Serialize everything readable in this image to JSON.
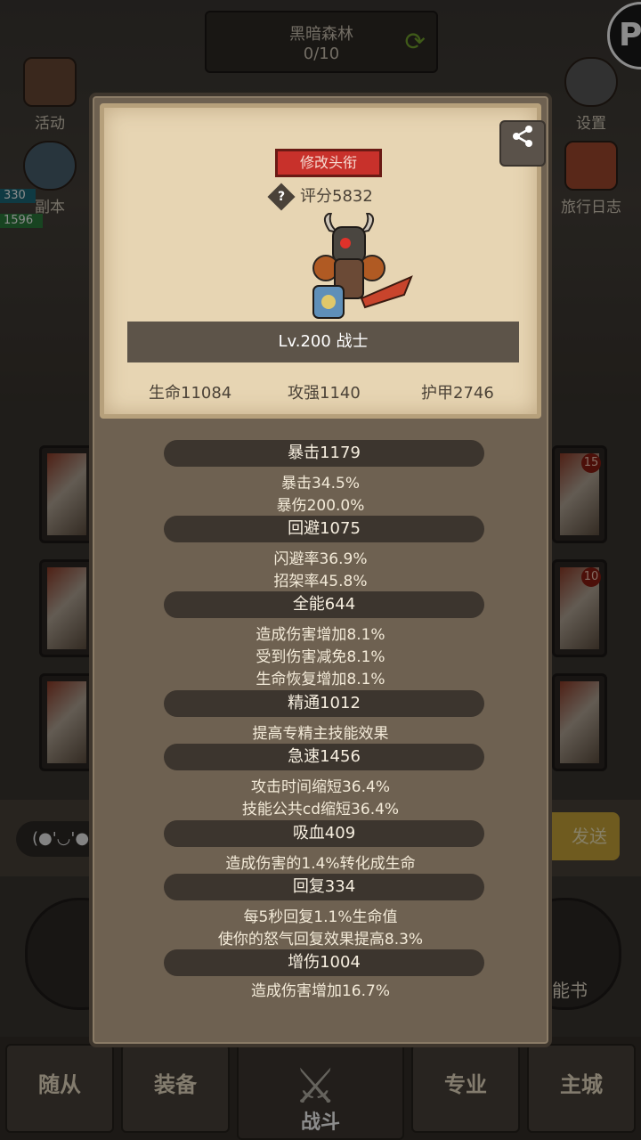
{
  "background": {
    "location_title": "黑暗森林",
    "location_progress": "0/10",
    "side_buttons": {
      "activity": "活动",
      "dungeon": "副本",
      "settings": "设置",
      "travel_log": "旅行日志"
    },
    "left_values": [
      "330",
      "1596"
    ],
    "slot_badges": [
      "15",
      "10"
    ],
    "chat_emoji": "(●'◡'●",
    "send_label": "发送",
    "skill_book_label": "能书"
  },
  "bottom_nav": {
    "follower": "随从",
    "equipment": "装备",
    "fight": "战斗",
    "profession": "专业",
    "main_city": "主城"
  },
  "modal": {
    "change_title_label": "修改头衔",
    "help_glyph": "?",
    "score": "评分5832",
    "name_level": "Lv.200 战士",
    "stats": {
      "hp": "生命11084",
      "attack": "攻强1140",
      "armor": "护甲2746"
    },
    "sections": [
      {
        "header": "暴击1179",
        "lines": [
          "暴击34.5%",
          "暴伤200.0%"
        ]
      },
      {
        "header": "回避1075",
        "lines": [
          "闪避率36.9%",
          "招架率45.8%"
        ]
      },
      {
        "header": "全能644",
        "lines": [
          "造成伤害增加8.1%",
          "受到伤害减免8.1%",
          "生命恢复增加8.1%"
        ]
      },
      {
        "header": "精通1012",
        "lines": [
          "提高专精主技能效果"
        ]
      },
      {
        "header": "急速1456",
        "lines": [
          "攻击时间缩短36.4%",
          "技能公共cd缩短36.4%"
        ]
      },
      {
        "header": "吸血409",
        "lines": [
          "造成伤害的1.4%转化成生命"
        ]
      },
      {
        "header": "回复334",
        "lines": [
          "每5秒回复1.1%生命值",
          "使你的怒气回复效果提高8.3%"
        ]
      },
      {
        "header": "增伤1004",
        "lines": [
          "造成伤害增加16.7%"
        ]
      }
    ]
  },
  "colors": {
    "title_button": "#c8312b",
    "parchment": "#e7d5b3",
    "modal_body": "#6e6151",
    "section_header": "#3c352e"
  }
}
